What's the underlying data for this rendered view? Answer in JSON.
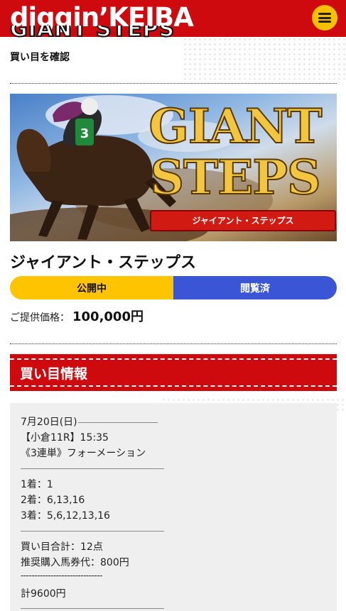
{
  "header": {
    "logo": "diggin’KEIBA",
    "menu_icon": "hamburger-menu-icon",
    "brand_color": "#cf0a0f",
    "menu_color": "#f6c000"
  },
  "page": {
    "title_cut": "GIANT STEPS",
    "subtitle": "買い目を確認"
  },
  "banner": {
    "title_line1": "GIANT",
    "title_line2": "STEPS",
    "ribbon": "ジャイアント・ステップス",
    "jockey_number": "3"
  },
  "product": {
    "name": "ジャイアント・ステップス",
    "status_open": "公開中",
    "status_viewed": "閲覧済",
    "price_label": "ご提供価格：",
    "price_value": "100,000円",
    "status_open_color": "#ffc400",
    "status_viewed_color": "#3a55d6"
  },
  "section": {
    "title": "買い目情報"
  },
  "bet_info": {
    "date": "7月20日(日)",
    "race": "【小倉11R】15:35",
    "bet_type": "《3連単》フォーメーション",
    "first": "1着：1",
    "second": "2着：6,13,16",
    "third": "3着：5,6,12,13,16",
    "total_points": "買い目合計：12点",
    "recommended": "推奨購入馬券代：800円",
    "separator": "------------------------------",
    "total": "計9600円"
  }
}
